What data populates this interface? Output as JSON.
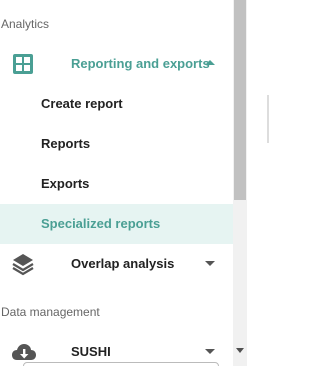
{
  "sidebar": {
    "analytics_header": "Analytics",
    "reporting": {
      "label": "Reporting and exports",
      "icon": "grid-icon",
      "expanded": true,
      "children": [
        {
          "label": "Create report"
        },
        {
          "label": "Reports"
        },
        {
          "label": "Exports"
        },
        {
          "label": "Specialized reports",
          "active": true
        }
      ]
    },
    "overlap": {
      "label": "Overlap analysis",
      "icon": "layers-icon"
    },
    "data_management_header": "Data management",
    "sushi": {
      "label": "SUSHI",
      "icon": "cloud-download-icon"
    }
  },
  "colors": {
    "accent": "#4a9f94",
    "active_background": "#e6f4f2",
    "text": "#222222",
    "header_text": "#666666"
  }
}
